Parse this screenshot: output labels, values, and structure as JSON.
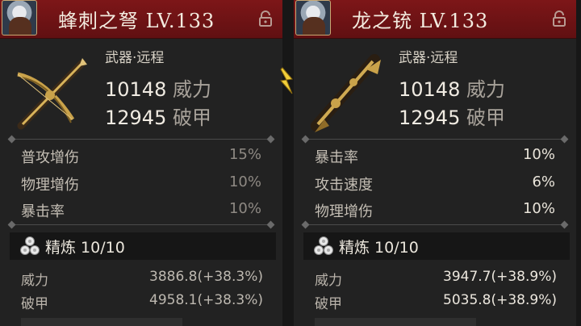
{
  "left": {
    "name": "蜂刺之弩",
    "level": "LV.133",
    "type": "武器·远程",
    "power_value": "10148",
    "power_label": "威力",
    "armor_value": "12945",
    "armor_label": "破甲",
    "subs": [
      {
        "name": "普攻增伤",
        "value": "15%"
      },
      {
        "name": "物理增伤",
        "value": "10%"
      },
      {
        "name": "暴击率",
        "value": "10%"
      }
    ],
    "refine": "精炼 10/10",
    "refine_stats": [
      {
        "name": "威力",
        "value": "3886.8(+38.3%)"
      },
      {
        "name": "破甲",
        "value": "4958.1(+38.3%)"
      }
    ]
  },
  "right": {
    "name": "龙之铳",
    "level": "LV.133",
    "type": "武器·远程",
    "power_value": "10148",
    "power_label": "威力",
    "armor_value": "12945",
    "armor_label": "破甲",
    "subs": [
      {
        "name": "暴击率",
        "value": "10%"
      },
      {
        "name": "攻击速度",
        "value": "6%"
      },
      {
        "name": "物理增伤",
        "value": "10%"
      }
    ],
    "refine": "精炼 10/10",
    "refine_stats": [
      {
        "name": "威力",
        "value": "3947.7(+38.9%)"
      },
      {
        "name": "破甲",
        "value": "5035.8(+38.9%)"
      }
    ]
  },
  "icons": {
    "avatar": "character-avatar",
    "lock": "padlock-icon",
    "refine": "refine-gems-icon",
    "compare": "lightning-arrow-icon"
  },
  "colors": {
    "header": "#7d1618",
    "gold": "#c9a24a",
    "compare_arrow": "#f2cf3a"
  }
}
